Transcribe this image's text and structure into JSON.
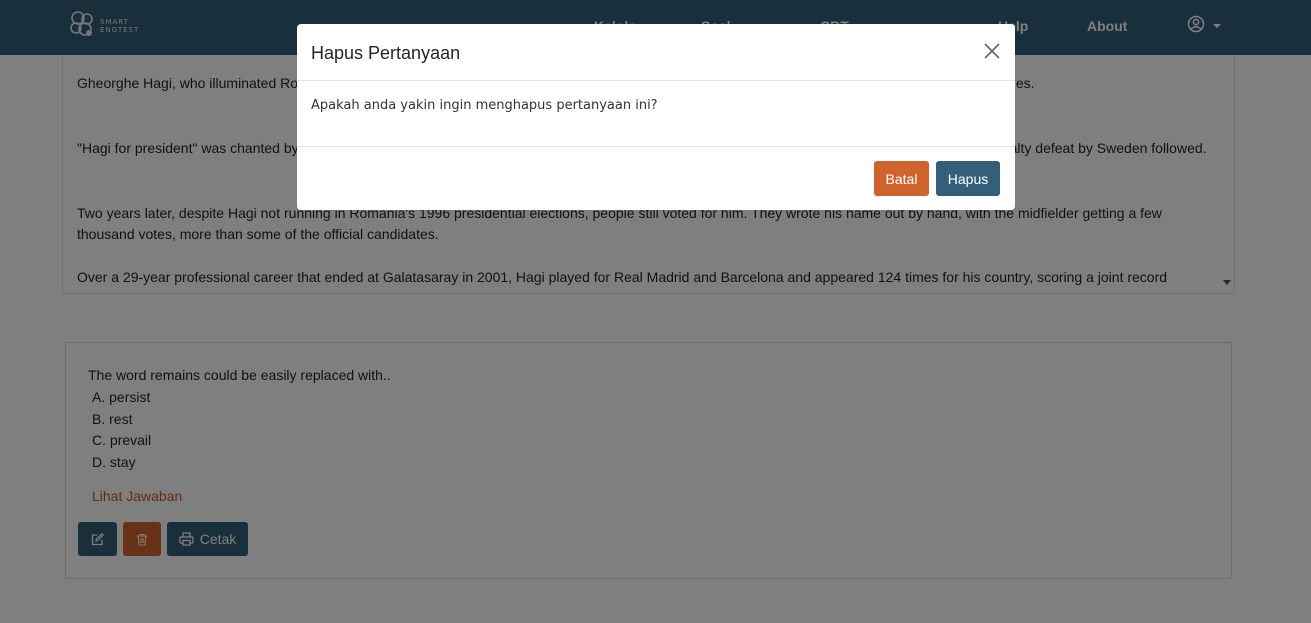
{
  "navbar": {
    "logo_text_line1": "SMART",
    "logo_text_line2": "ENGTEST",
    "items": [
      "Kelola",
      "Soal",
      "CBT",
      "Help",
      "About"
    ]
  },
  "passage": {
    "paragraphs": [
      "Gheorghe Hagi, who illuminated Romania's golden generation as a player, has now returned to their national team on a mission to transform their fortunes.",
      "\"Hagi for president\" was chanted by crowds after he led Romania to their best-ever finish when they reached the World Cup quarter-finals in 1994. Penalty defeat by Sweden followed.",
      "Two years later, despite Hagi not running in Romania's 1996 presidential elections, people still voted for him. They wrote his name out by hand, with the midfielder getting a few thousand votes, more than some of the official candidates.",
      "Over a 29-year professional career that ended at Galatasaray in 2001, Hagi played for Real Madrid and Barcelona and appeared 124 times for his country, scoring a joint record"
    ]
  },
  "question": {
    "text": "The word remains could be easily replaced with..",
    "options": [
      "A. persist",
      "B. rest",
      "C. prevail",
      "D. stay"
    ],
    "answer_link": "Lihat Jawaban",
    "print_label": "Cetak"
  },
  "modal": {
    "title": "Hapus Pertanyaan",
    "body": "Apakah anda yakin ingin menghapus pertanyaan ini?",
    "cancel_label": "Batal",
    "confirm_label": "Hapus"
  },
  "colors": {
    "navbar": "#336078",
    "primary": "#336078",
    "danger": "#d0642e",
    "link": "#c85a2b"
  }
}
